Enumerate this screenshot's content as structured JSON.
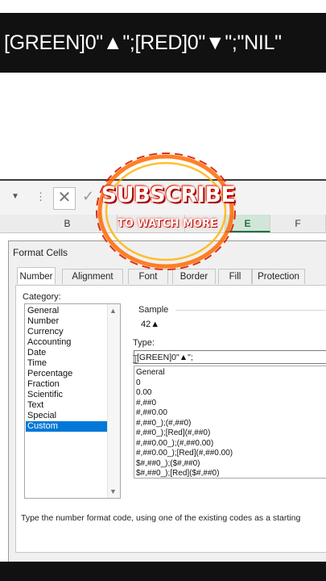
{
  "banner": {
    "text": "[GREEN]0\"▲\";[RED]0\"▼\";\"NIL\""
  },
  "formula_bar": {
    "name_dropdown_icon": "chevron-down-icon",
    "separator": "⋮",
    "cancel_symbol": "✕",
    "enter_symbol": "✓"
  },
  "columns": [
    "B",
    "E",
    "F"
  ],
  "overlay": {
    "subscribe": "SUBSCRIBE",
    "watch": "TO WATCH MORE"
  },
  "dialog": {
    "title": "Format Cells",
    "tabs": [
      "Number",
      "Alignment",
      "Font",
      "Border",
      "Fill",
      "Protection"
    ],
    "active_tab": "Number",
    "category_label": "Category:",
    "categories": [
      "General",
      "Number",
      "Currency",
      "Accounting",
      "Date",
      "Time",
      "Percentage",
      "Fraction",
      "Scientific",
      "Text",
      "Special",
      "Custom"
    ],
    "selected_category": "Custom",
    "sample_label": "Sample",
    "sample_value": "42▲",
    "type_label": "Type:",
    "type_value": "[GREEN]0\"▲\";",
    "type_options": [
      "General",
      "0",
      "0.00",
      "#,##0",
      "#,##0.00",
      "#,##0_);(#,##0)",
      "#,##0_);[Red](#,##0)",
      "#,##0.00_);(#,##0.00)",
      "#,##0.00_);[Red](#,##0.00)",
      "$#,##0_);($#,##0)",
      "$#,##0_);[Red]($#,##0)"
    ],
    "hint": "Type the number format code, using one of the existing codes as a starting"
  },
  "colors": {
    "accent_green": "#217346",
    "selection_blue": "#0078d7",
    "banner_bg": "#111111"
  }
}
